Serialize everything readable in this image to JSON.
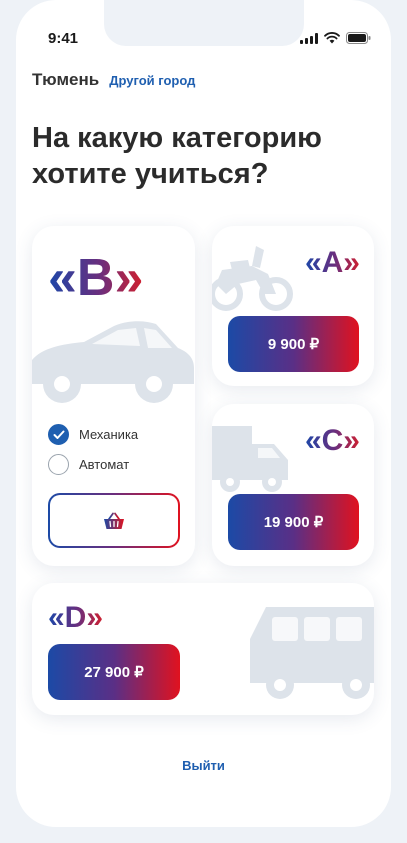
{
  "status_bar": {
    "time": "9:41"
  },
  "location": {
    "city": "Тюмень",
    "change_city_label": "Другой город"
  },
  "heading": "На какую категорию хотите учиться?",
  "categories": [
    {
      "label": "«B»",
      "icon": "car-icon",
      "transmission_options": [
        {
          "label": "Механика",
          "selected": true
        },
        {
          "label": "Автомат",
          "selected": false
        }
      ],
      "action_icon": "basket-icon"
    },
    {
      "label": "«A»",
      "icon": "motorcycle-icon",
      "price": "9 900 ₽"
    },
    {
      "label": "«C»",
      "icon": "truck-icon",
      "price": "19 900 ₽"
    },
    {
      "label": "«D»",
      "icon": "bus-icon",
      "price": "27 900 ₽"
    }
  ],
  "logout_label": "Выйти",
  "colors": {
    "accent_blue": "#1c4aa6",
    "accent_red": "#e0121f",
    "link_blue": "#1f5fb0",
    "silhouette": "#dde3ea"
  }
}
